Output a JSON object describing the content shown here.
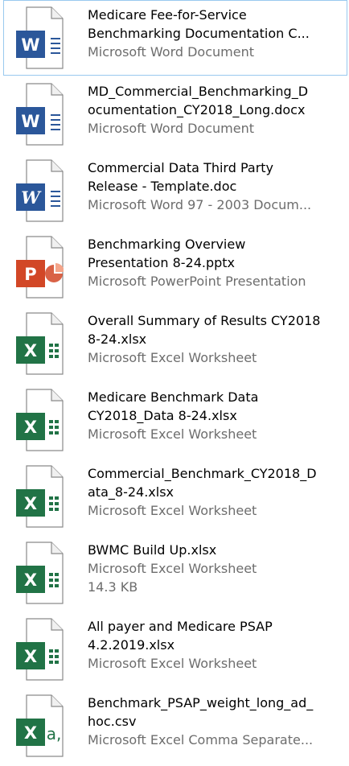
{
  "files": [
    {
      "icon": "word-document-icon",
      "type": "word",
      "name_lines": [
        "Medicare Fee-for-Service",
        "Benchmarking Documentation C..."
      ],
      "detail_lines": [
        "Microsoft Word Document"
      ],
      "selected": true
    },
    {
      "icon": "word-document-icon",
      "type": "word",
      "name_lines": [
        "MD_Commercial_Benchmarking_D",
        "ocumentation_CY2018_Long.docx"
      ],
      "detail_lines": [
        "Microsoft Word Document"
      ],
      "selected": false
    },
    {
      "icon": "word-97-document-icon",
      "type": "word97",
      "name_lines": [
        "Commercial Data Third Party",
        "Release - Template.doc"
      ],
      "detail_lines": [
        "Microsoft Word 97 - 2003 Docum..."
      ],
      "selected": false
    },
    {
      "icon": "powerpoint-presentation-icon",
      "type": "powerpoint",
      "name_lines": [
        "Benchmarking Overview",
        "Presentation 8-24.pptx"
      ],
      "detail_lines": [
        "Microsoft PowerPoint Presentation"
      ],
      "selected": false
    },
    {
      "icon": "excel-worksheet-icon",
      "type": "excel",
      "name_lines": [
        "Overall Summary of Results CY2018",
        "8-24.xlsx"
      ],
      "detail_lines": [
        "Microsoft Excel Worksheet"
      ],
      "selected": false
    },
    {
      "icon": "excel-worksheet-icon",
      "type": "excel",
      "name_lines": [
        "Medicare Benchmark Data",
        "CY2018_Data 8-24.xlsx"
      ],
      "detail_lines": [
        "Microsoft Excel Worksheet"
      ],
      "selected": false
    },
    {
      "icon": "excel-worksheet-icon",
      "type": "excel",
      "name_lines": [
        "Commercial_Benchmark_CY2018_D",
        "ata_8-24.xlsx"
      ],
      "detail_lines": [
        "Microsoft Excel Worksheet"
      ],
      "selected": false
    },
    {
      "icon": "excel-worksheet-icon",
      "type": "excel",
      "name_lines": [
        "BWMC Build Up.xlsx"
      ],
      "detail_lines": [
        "Microsoft Excel Worksheet",
        "14.3 KB"
      ],
      "selected": false
    },
    {
      "icon": "excel-worksheet-icon",
      "type": "excel",
      "name_lines": [
        "All payer and Medicare PSAP",
        "4.2.2019.xlsx"
      ],
      "detail_lines": [
        "Microsoft Excel Worksheet"
      ],
      "selected": false
    },
    {
      "icon": "excel-csv-icon",
      "type": "csv",
      "name_lines": [
        "Benchmark_PSAP_weight_long_ad_",
        "hoc.csv"
      ],
      "detail_lines": [
        "Microsoft Excel Comma Separate..."
      ],
      "selected": false
    }
  ],
  "colors": {
    "word": "#2b579a",
    "powerpoint": "#d24726",
    "excel": "#217346",
    "selection_border": "#99c9ef",
    "detail_text": "#6d6d6d"
  }
}
